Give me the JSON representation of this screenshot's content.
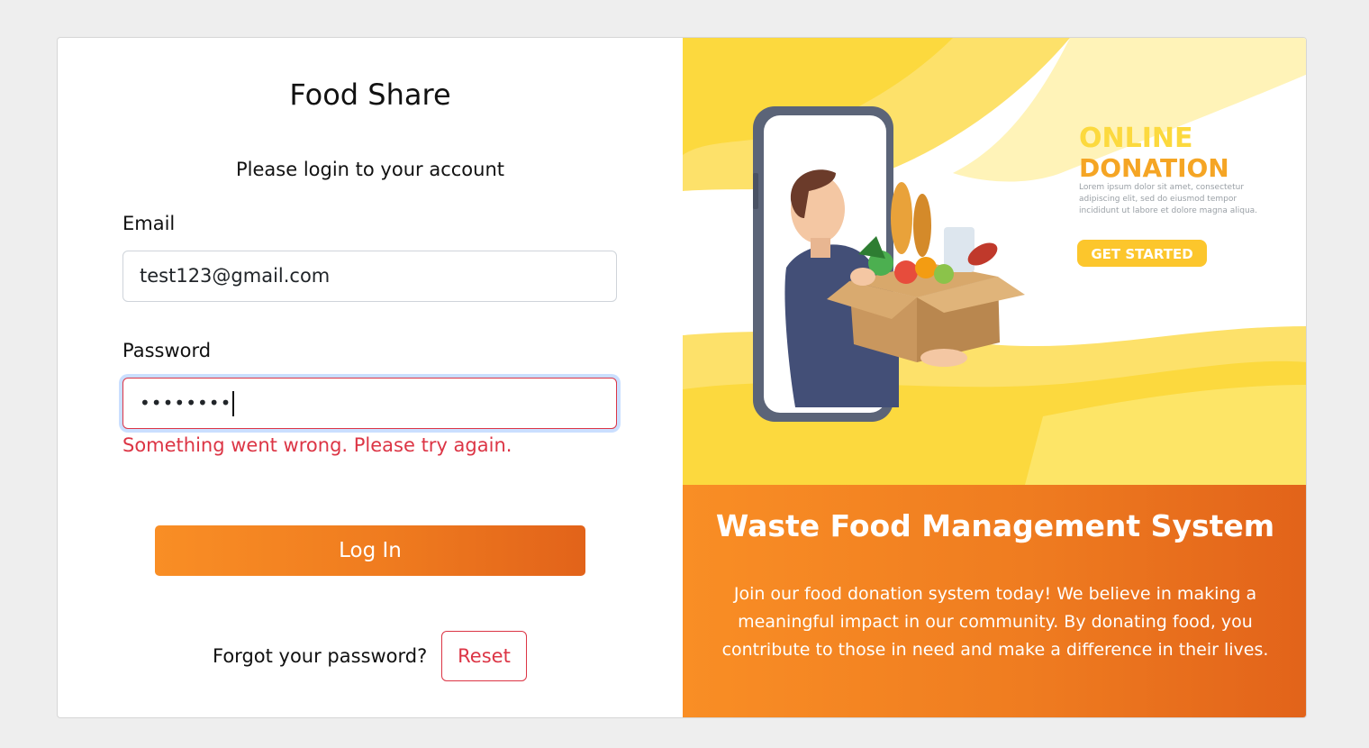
{
  "login": {
    "title": "Food Share",
    "subtitle": "Please login to your account",
    "email_label": "Email",
    "email_value": "test123@gmail.com",
    "password_label": "Password",
    "password_value": "••••••••",
    "error": "Something went wrong. Please try again.",
    "login_button": "Log In",
    "forgot_text": "Forgot your password?",
    "reset_button": "Reset"
  },
  "promo": {
    "image": {
      "heading_line1": "ONLINE",
      "heading_line2": "DONATION",
      "lorem": "Lorem ipsum dolor sit amet, consectetur adipiscing elit, sed do eiusmod tempor incididunt ut labore et dolore magna aliqua.",
      "cta": "GET STARTED"
    },
    "title": "Waste Food Management System",
    "description": "Join our food donation system today! We believe in making a meaningful impact in our community. By donating food, you contribute to those in need and make a difference in their lives."
  },
  "colors": {
    "accent_orange": "#f38a23",
    "error_red": "#dc3545",
    "illustration_yellow": "#fcd93e"
  }
}
